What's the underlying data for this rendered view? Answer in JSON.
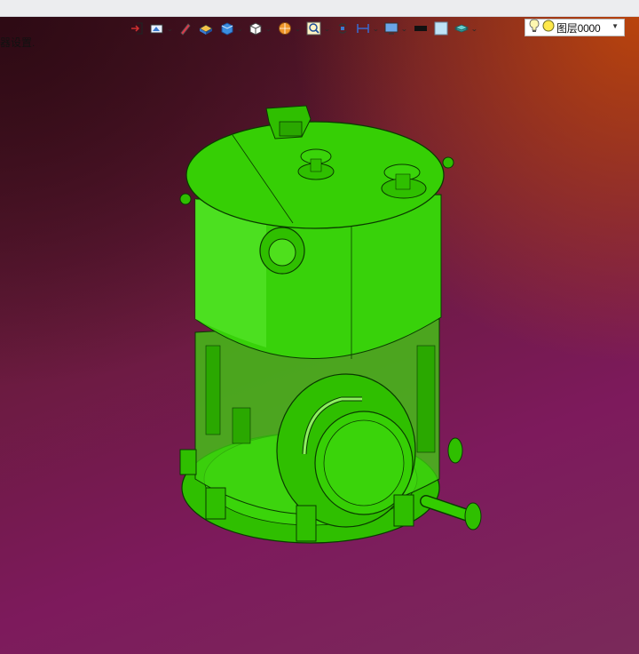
{
  "window": {
    "titlebar_color": "#ecedef"
  },
  "status": {
    "text": "器设置."
  },
  "toolbar": {
    "items": [
      {
        "icon": "exit-icon"
      },
      {
        "icon": "view-orient-icon",
        "dropdown": true
      },
      {
        "icon": "pen-icon"
      },
      {
        "icon": "solid-shade-icon"
      },
      {
        "icon": "cube-shade-icon",
        "dropdown": true
      },
      {
        "icon": "white-cube-icon",
        "dropdown": true
      },
      {
        "icon": "ball-render-icon",
        "dropdown": true
      },
      {
        "icon": "zoom-icon",
        "dropdown": true
      },
      {
        "icon": "rotate-icon"
      },
      {
        "icon": "section-icon",
        "dropdown": true
      },
      {
        "icon": "monitor-icon",
        "dropdown": true
      },
      {
        "icon": "black-color-icon"
      },
      {
        "icon": "lightblue-color-icon"
      },
      {
        "icon": "layer-stack-icon",
        "dropdown": true
      }
    ],
    "layer": {
      "label": "图层0000",
      "icons": [
        "lightbulb-icon",
        "yellow-dot-icon"
      ]
    }
  },
  "viewport": {
    "model_color": "#33cc00",
    "background_colors": [
      "#2d0a14",
      "#be460a",
      "#7d1a5c"
    ]
  }
}
